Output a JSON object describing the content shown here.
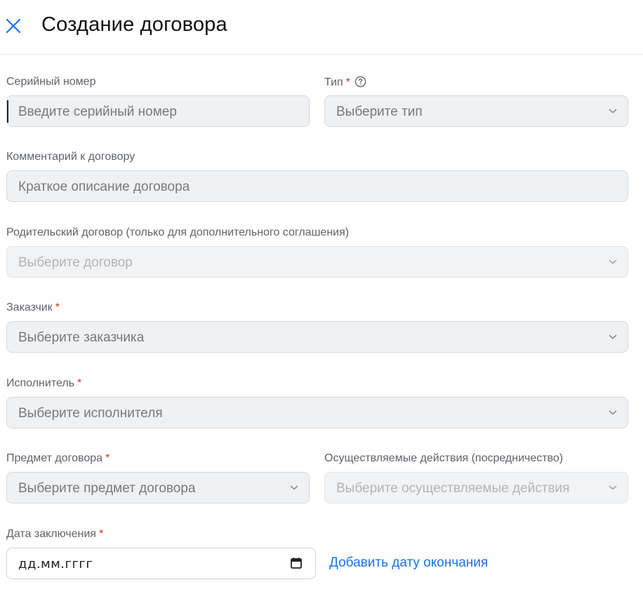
{
  "header": {
    "title": "Создание договора"
  },
  "form": {
    "serial_number": {
      "label": "Серийный номер",
      "placeholder": "Введите серийный номер"
    },
    "type": {
      "label": "Тип",
      "required_mark": "*",
      "placeholder": "Выберите тип"
    },
    "comment": {
      "label": "Комментарий к договору",
      "placeholder": "Краткое описание договора"
    },
    "parent_contract": {
      "label": "Родительский договор (только для дополнительного соглашения)",
      "placeholder": "Выберите договор"
    },
    "customer": {
      "label": "Заказчик",
      "required_mark": "*",
      "placeholder": "Выберите заказчика"
    },
    "executor": {
      "label": "Исполнитель",
      "required_mark": "*",
      "placeholder": "Выберите исполнителя"
    },
    "subject": {
      "label": "Предмет договора",
      "required_mark": "*",
      "placeholder": "Выберите предмет договора"
    },
    "actions": {
      "label": "Осуществляемые действия (посредничество)",
      "placeholder": "Выберите осуществляемые действия"
    },
    "conclusion_date": {
      "label": "Дата заключения",
      "required_mark": "*",
      "placeholder": "дд.мм.гггг"
    },
    "add_end_date_link": "Добавить дату окончания"
  },
  "colors": {
    "accent": "#1a73e8",
    "required": "#d93025",
    "field_bg": "#eff1f3"
  },
  "icons": {
    "close": "close-icon",
    "help": "help-icon",
    "caret": "chevron-down-icon",
    "calendar": "calendar-icon"
  }
}
